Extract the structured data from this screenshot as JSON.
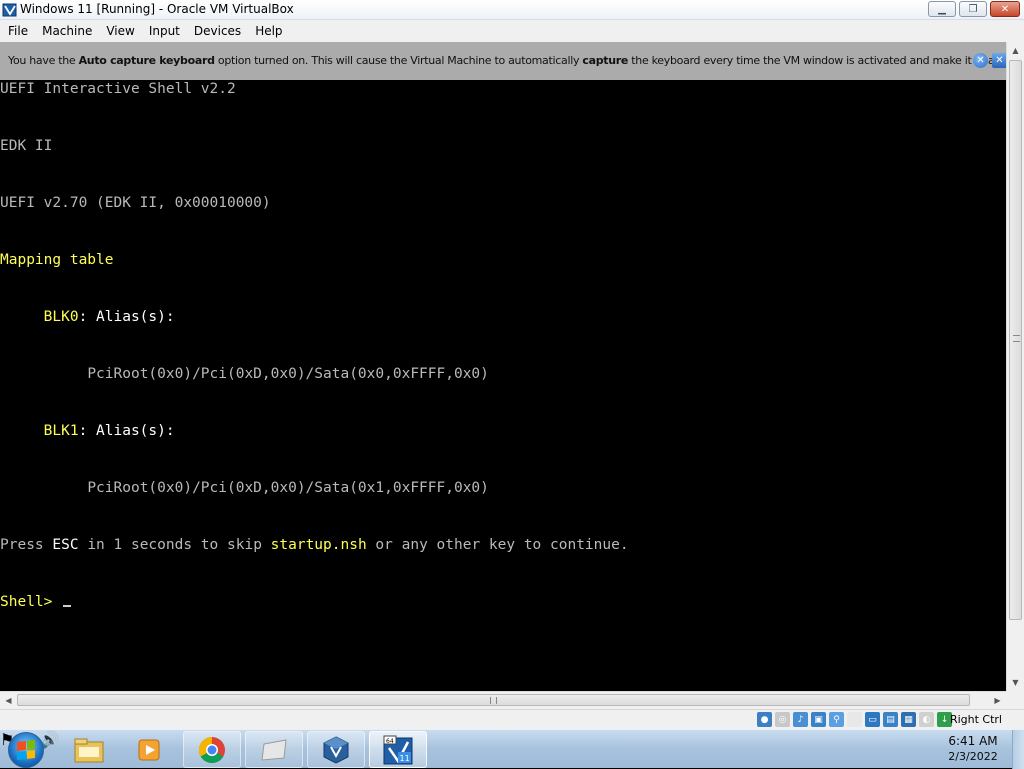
{
  "window": {
    "title": "Windows 11 [Running] - Oracle VM VirtualBox",
    "icon": "virtualbox-icon",
    "controls": [
      "minimize-icon",
      "maximize-icon",
      "close-icon"
    ]
  },
  "menubar": {
    "items": [
      "File",
      "Machine",
      "View",
      "Input",
      "Devices",
      "Help"
    ]
  },
  "notification": {
    "pre": "You have the ",
    "bold1": "Auto capture keyboard",
    "mid": " option turned on. This will cause the Virtual Machine to automatically ",
    "bold2": "capture",
    "post": " the keyboard every time the VM window is activated and make it unavailable to"
  },
  "console": {
    "line0": "UEFI Interactive Shell v2.2",
    "line1": "EDK II",
    "line2": "UEFI v2.70 (EDK II, 0x00010000)",
    "line3": "Mapping table",
    "blk0_name": "BLK0",
    "blk0_alias": ": Alias(s):",
    "blk0_path": "PciRoot(0x0)/Pci(0xD,0x0)/Sata(0x0,0xFFFF,0x0)",
    "blk1_name": "BLK1",
    "blk1_alias": ": Alias(s):",
    "blk1_path": "PciRoot(0x0)/Pci(0xD,0x0)/Sata(0x1,0xFFFF,0x0)",
    "press_pre": "Press ",
    "press_esc": "ESC",
    "press_mid": " in 1 seconds to skip ",
    "press_script": "startup.nsh",
    "press_post": " or any other key to continue.",
    "prompt": "Shell> "
  },
  "statusbar": {
    "host_key": "Right Ctrl",
    "icons": [
      "hard-disk-icon",
      "optical-drive-icon",
      "audio-icon",
      "network-icon",
      "usb-icon",
      "shared-folders-icon",
      "display-icon",
      "video-capture-icon",
      "cpu-icon",
      "mouse-integration-icon",
      "keyboard-capture-icon"
    ]
  },
  "taskbar": {
    "items": [
      "explorer",
      "media-player",
      "chrome",
      "app-window",
      "virtualbox",
      "windows-11-vm"
    ],
    "clock_time": "6:41 AM",
    "clock_date": "2/3/2022"
  },
  "colors": {
    "console_text": "#b9b9b9",
    "console_highlight": "#ffff55",
    "console_bright": "#ffffff",
    "notice_bg": "#d6d6d6",
    "taskbar": "#a7c2dd"
  }
}
